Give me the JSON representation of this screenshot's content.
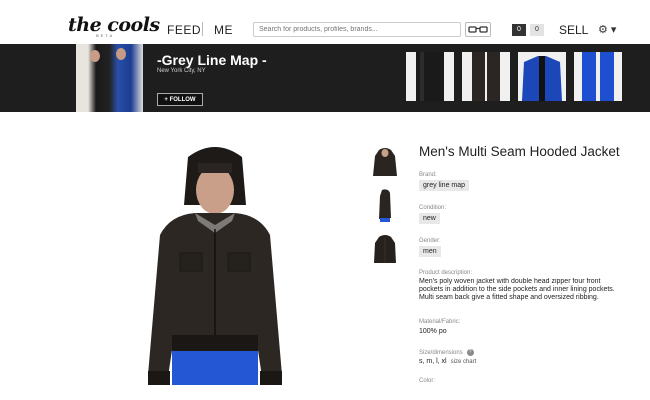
{
  "nav": {
    "logo": "the cools",
    "logo_sub": "BETA",
    "feed": "FEED",
    "me": "ME",
    "search_placeholder": "Search for products, profiles, brands...",
    "count_left": "0",
    "count_right": "0",
    "sell": "SELL",
    "settings_glyph": "⚙ ▾"
  },
  "profile": {
    "name": "-Grey Line Map -",
    "location": "New York City, NY",
    "follow_label": "+  FOLLOW"
  },
  "product": {
    "title": "Men's Multi Seam Hooded Jacket",
    "brand_label": "Brand:",
    "brand": "grey line map",
    "condition_label": "Condition:",
    "condition": "new",
    "gender_label": "Gender:",
    "gender": "men",
    "description_label": "Product description:",
    "description": "Men's poly woven jacket with double head zipper four front pockets in addition to the side pockets and inner lining pockets. Multi seam back give a fitted shape and oversized ribbing.",
    "material_label": "Material/Fabric:",
    "material": "100% po",
    "size_label": "Size/dimensions",
    "sizes": "s, m, l, xl",
    "size_chart": "size chart",
    "color_label": "Color:"
  }
}
